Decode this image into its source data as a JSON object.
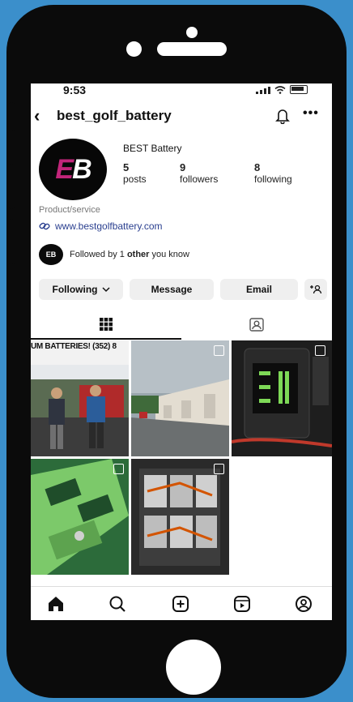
{
  "status": {
    "time": "9:53"
  },
  "profile": {
    "handle": "best_golf_battery",
    "name": "BEST Battery",
    "avatar_text_a": "E",
    "avatar_text_b": "B",
    "posts": {
      "count": "5",
      "label": "posts"
    },
    "followers": {
      "count": "9",
      "label": "followers"
    },
    "following": {
      "count": "8",
      "label": "following"
    },
    "category": "Product/service",
    "website": "www.bestgolfbattery.com",
    "followed_by_prefix": "Followed by 1 ",
    "followed_by_bold": "other",
    "followed_by_suffix": " you know",
    "mini_avatar_text": "EB"
  },
  "buttons": {
    "following": "Following",
    "message": "Message",
    "email": "Email"
  },
  "posts": [
    {
      "caption": "UM BATTERIES! (352) 8"
    }
  ],
  "colors": {
    "accent": "#c2257a",
    "link": "#2a3f8f",
    "frame": "#3b8fcb"
  }
}
